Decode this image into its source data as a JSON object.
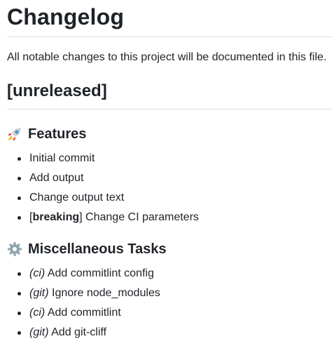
{
  "title": "Changelog",
  "intro": "All notable changes to this project will be documented in this file.",
  "release": {
    "heading": "[unreleased]"
  },
  "sections": [
    {
      "icon": "rocket-icon",
      "heading": "Features",
      "items": [
        {
          "text": "Initial commit"
        },
        {
          "text": "Add output"
        },
        {
          "text": "Change output text"
        },
        {
          "bracket_open": "[",
          "bold": "breaking",
          "bracket_close": "]",
          "text": " Change CI parameters"
        }
      ]
    },
    {
      "icon": "gear-icon",
      "heading": "Miscellaneous Tasks",
      "items": [
        {
          "scope": "(ci)",
          "text": " Add commitlint config"
        },
        {
          "scope": "(git)",
          "text": " Ignore node_modules"
        },
        {
          "scope": "(ci)",
          "text": " Add commitlint"
        },
        {
          "scope": "(git)",
          "text": " Add git-cliff"
        }
      ]
    }
  ],
  "colors": {
    "text": "#1f2328",
    "rule": "#d8dee4",
    "background": "#ffffff"
  }
}
